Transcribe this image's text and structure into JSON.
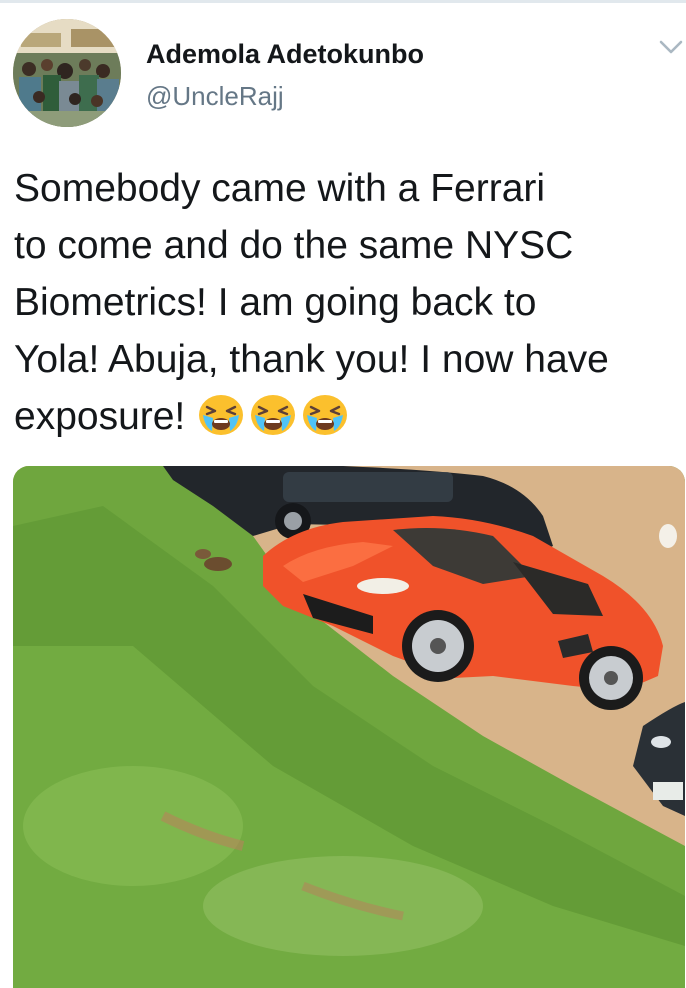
{
  "tweet": {
    "author": {
      "display_name": "Ademola Adetokunbo",
      "handle": "@UncleRajj"
    },
    "text_lines": [
      "Somebody came with a Ferrari",
      "to come and do the same NYSC",
      "Biometrics! I am going back to",
      "Yola! Abuja, thank you! I now have",
      "exposure!"
    ],
    "emojis": [
      "loudly-crying-face-emoji",
      "loudly-crying-face-emoji",
      "loudly-crying-face-emoji"
    ],
    "media": {
      "type": "photo",
      "subject": "orange sports car parked beside grassy slope"
    }
  },
  "colors": {
    "name": "#14171a",
    "handle": "#657786",
    "caret": "#aab8c2",
    "divider": "#e1e8ed",
    "car": "#f0522a",
    "grass": "#6a9f3c"
  },
  "icons": {
    "menu_caret": "chevron-down-icon"
  }
}
